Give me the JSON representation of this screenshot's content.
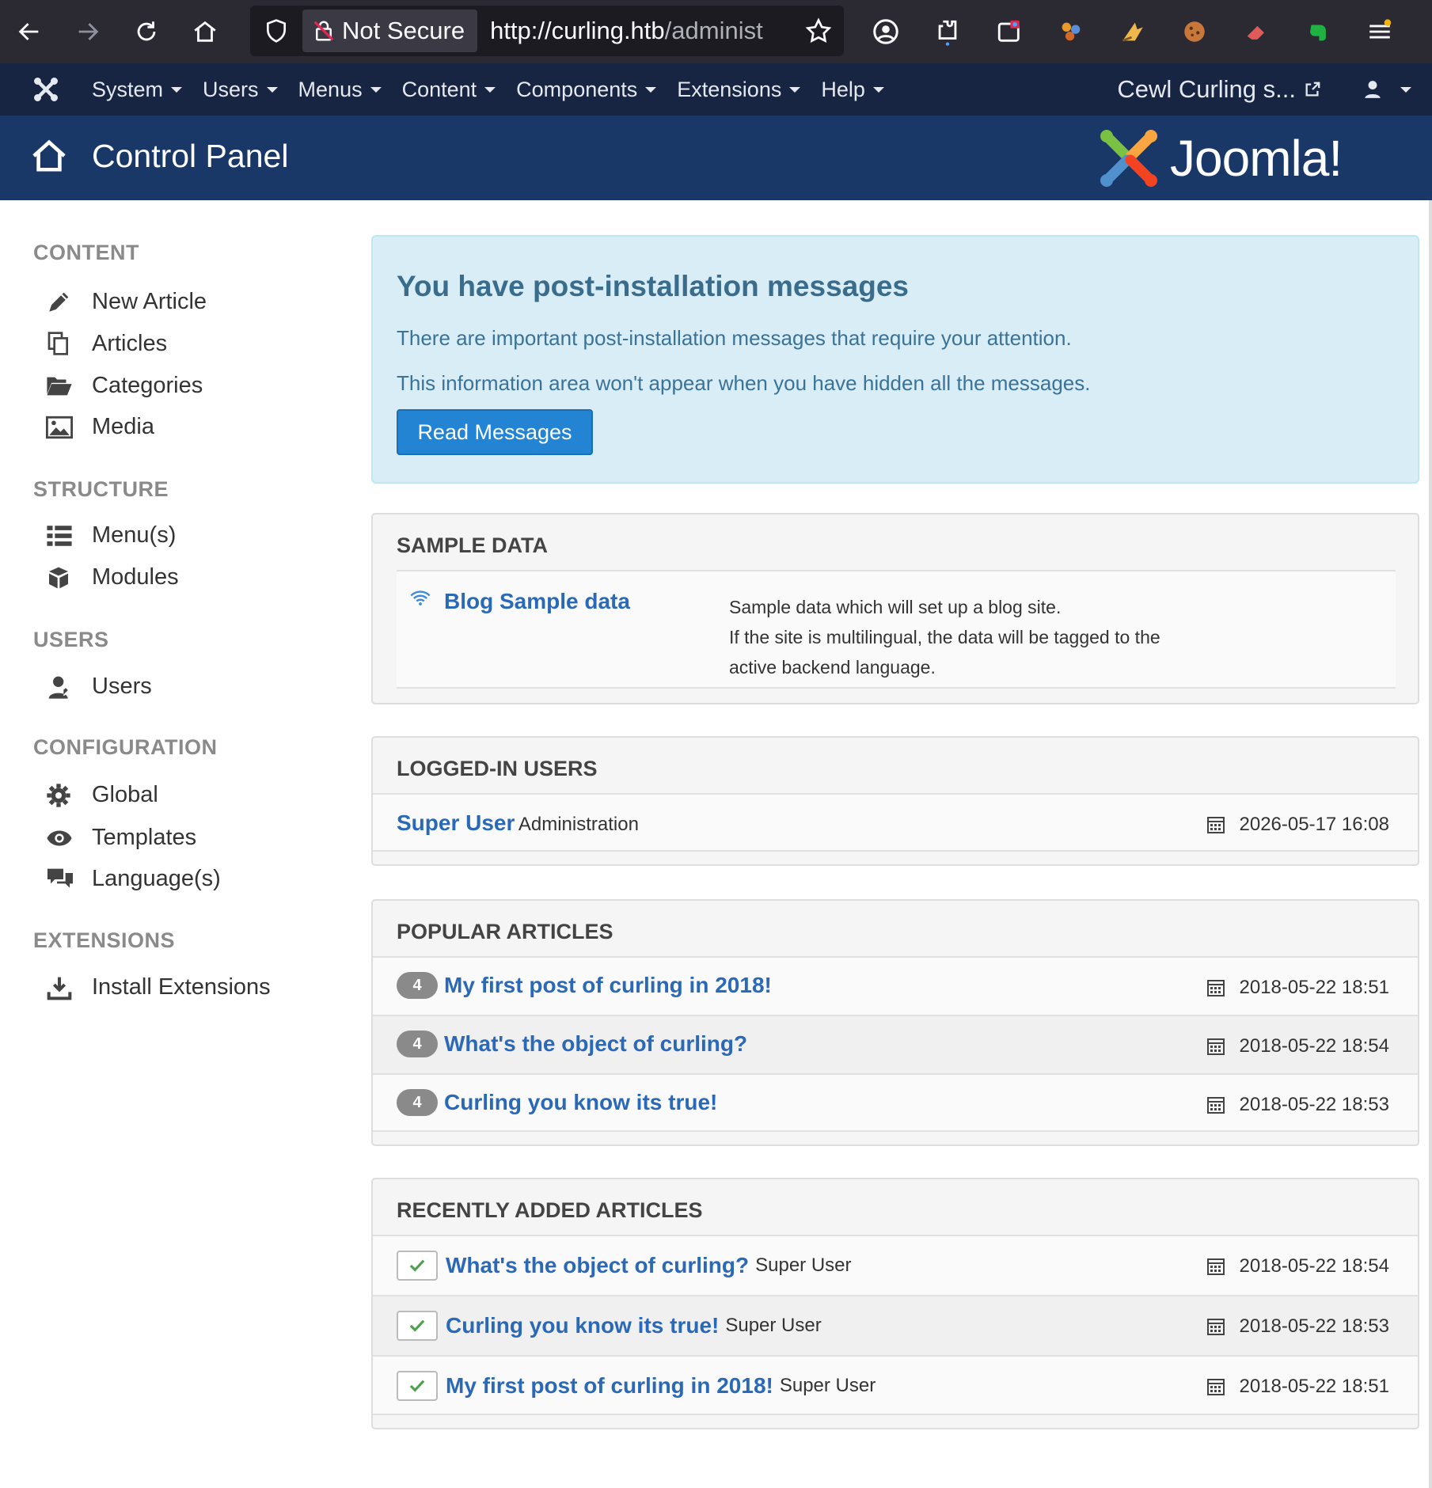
{
  "browser": {
    "not_secure": "Not Secure",
    "url_main": "http://curling.htb",
    "url_rest": "/administ"
  },
  "topnav": {
    "items": [
      "System",
      "Users",
      "Menus",
      "Content",
      "Components",
      "Extensions",
      "Help"
    ],
    "site_link": "Cewl Curling s..."
  },
  "header": {
    "title": "Control Panel",
    "brand": "Joomla!"
  },
  "sidebar": {
    "content_head": "CONTENT",
    "new_article": "New Article",
    "articles": "Articles",
    "categories": "Categories",
    "media": "Media",
    "structure_head": "STRUCTURE",
    "menus": "Menu(s)",
    "modules": "Modules",
    "users_head": "USERS",
    "users": "Users",
    "configuration_head": "CONFIGURATION",
    "global": "Global",
    "templates": "Templates",
    "languages": "Language(s)",
    "extensions_head": "EXTENSIONS",
    "install_extensions": "Install Extensions"
  },
  "alert": {
    "title": "You have post-installation messages",
    "line1": "There are important post-installation messages that require your attention.",
    "line2": "This information area won't appear when you have hidden all the messages.",
    "button": "Read Messages"
  },
  "sample_data": {
    "title": "SAMPLE DATA",
    "item_name": "Blog Sample data",
    "desc1": "Sample data which will set up a blog site.",
    "desc2": "If the site is multilingual, the data will be tagged to the",
    "desc3": "active backend language."
  },
  "logged_in": {
    "title": "LOGGED-IN USERS",
    "user": "Super User",
    "location": "Administration",
    "date": "2026-05-17 16:08"
  },
  "popular": {
    "title": "POPULAR ARTICLES",
    "rows": [
      {
        "hits": "4",
        "title": "My first post of curling in 2018!",
        "date": "2018-05-22 18:51"
      },
      {
        "hits": "4",
        "title": "What's the object of curling?",
        "date": "2018-05-22 18:54"
      },
      {
        "hits": "4",
        "title": "Curling you know its true!",
        "date": "2018-05-22 18:53"
      }
    ]
  },
  "recent": {
    "title": "RECENTLY ADDED ARTICLES",
    "rows": [
      {
        "title": "What's the object of curling?",
        "author": "Super User",
        "date": "2018-05-22 18:54"
      },
      {
        "title": "Curling you know its true!",
        "author": "Super User",
        "date": "2018-05-22 18:53"
      },
      {
        "title": "My first post of curling in 2018!",
        "author": "Super User",
        "date": "2018-05-22 18:51"
      }
    ]
  }
}
